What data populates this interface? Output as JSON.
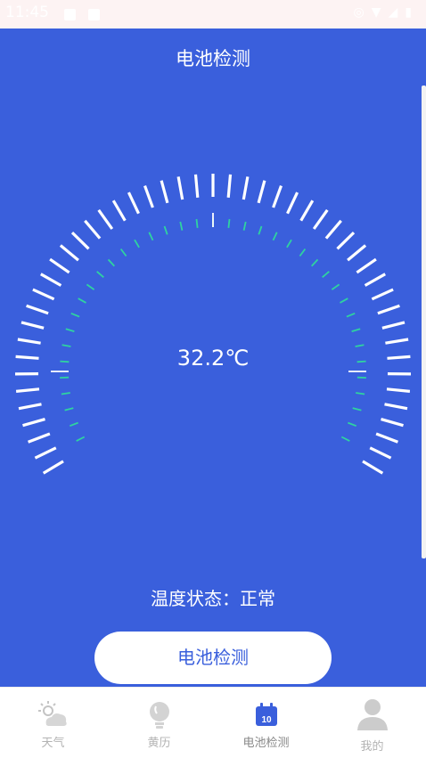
{
  "status_bar": {
    "time": "11:45"
  },
  "header": {
    "title": "电池检测"
  },
  "gauge": {
    "temperature": "32.2℃",
    "status": "温度状态：正常"
  },
  "actions": {
    "check_button": "电池检测"
  },
  "tabbar": {
    "tabs": [
      {
        "label": "天气",
        "icon": "weather-icon"
      },
      {
        "label": "黄历",
        "icon": "lightbulb-icon"
      },
      {
        "label": "电池检测",
        "icon": "calendar-icon",
        "active": true
      },
      {
        "label": "我的",
        "icon": "user-icon"
      }
    ]
  },
  "colors": {
    "primary": "#3a5fdc",
    "tick_white": "#ffffff",
    "tick_green": "#2fd3a0"
  }
}
